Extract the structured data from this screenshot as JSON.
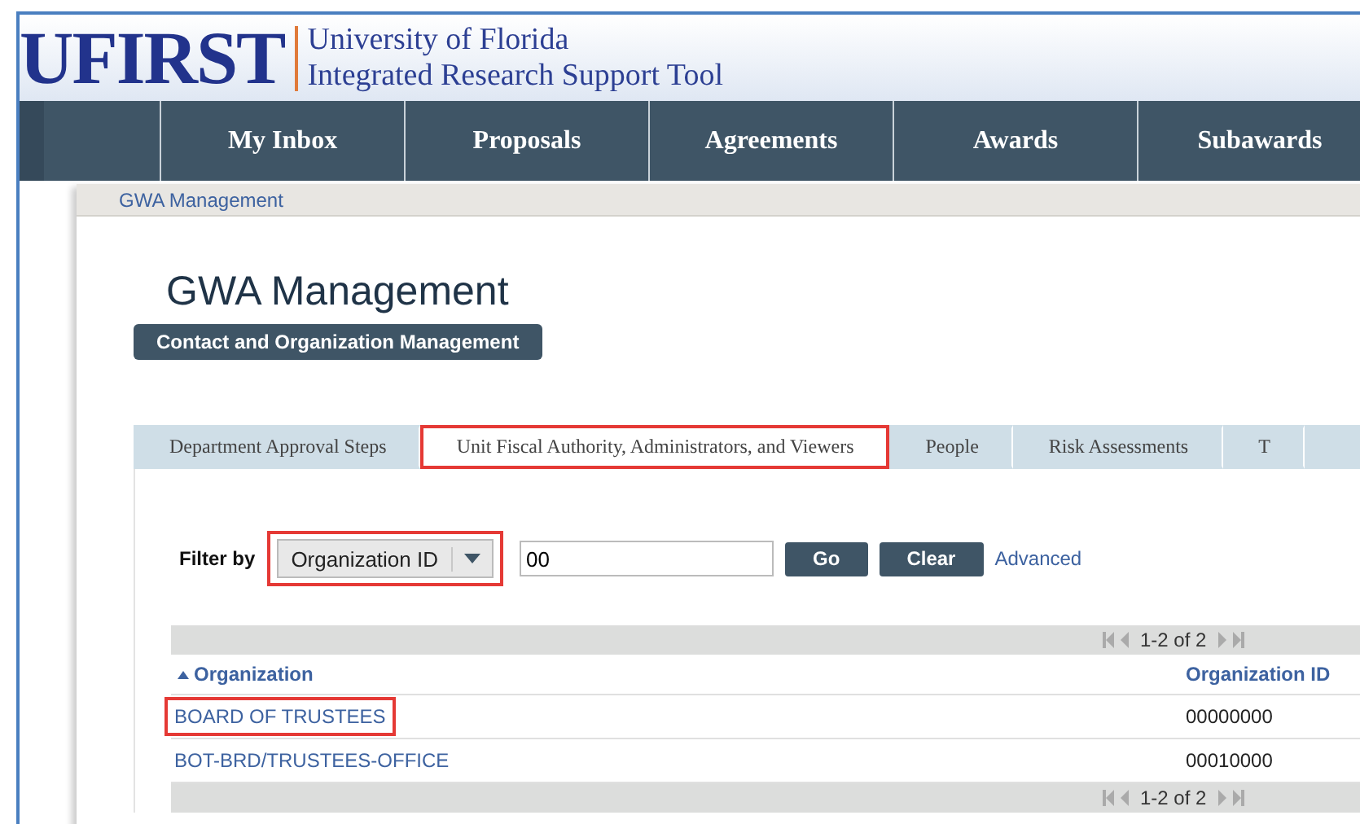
{
  "header": {
    "logo": "UFIRST",
    "title_line_1": "University of Florida",
    "title_line_2": "Integrated Research Support Tool"
  },
  "nav": [
    {
      "label": "My Inbox"
    },
    {
      "label": "Proposals"
    },
    {
      "label": "Agreements"
    },
    {
      "label": "Awards"
    },
    {
      "label": "Subawards"
    }
  ],
  "breadcrumb": "GWA Management",
  "page_title": "GWA Management",
  "action_button": "Contact and Organization Management",
  "tabs": [
    {
      "label": "Department Approval Steps",
      "selected": false,
      "highlighted": false
    },
    {
      "label": "Unit Fiscal Authority, Administrators, and Viewers",
      "selected": true,
      "highlighted": true
    },
    {
      "label": "People",
      "selected": false,
      "highlighted": false
    },
    {
      "label": "Risk Assessments",
      "selected": false,
      "highlighted": false
    },
    {
      "label": "T",
      "selected": false,
      "highlighted": false
    }
  ],
  "filter": {
    "label": "Filter by",
    "field": "Organization ID",
    "field_highlighted": true,
    "value": "00",
    "buttons": [
      "Go",
      "Clear"
    ],
    "link": "Advanced"
  },
  "table": {
    "pager": "1-2 of 2",
    "columns": [
      "Organization",
      "Organization ID"
    ],
    "rows": [
      {
        "organization": "BOARD OF TRUSTEES",
        "id": "00000000",
        "highlighted": true
      },
      {
        "organization": "BOT-BRD/TRUSTEES-OFFICE",
        "id": "00010000",
        "highlighted": false
      }
    ],
    "footer_pager": "1-2 of 2"
  }
}
